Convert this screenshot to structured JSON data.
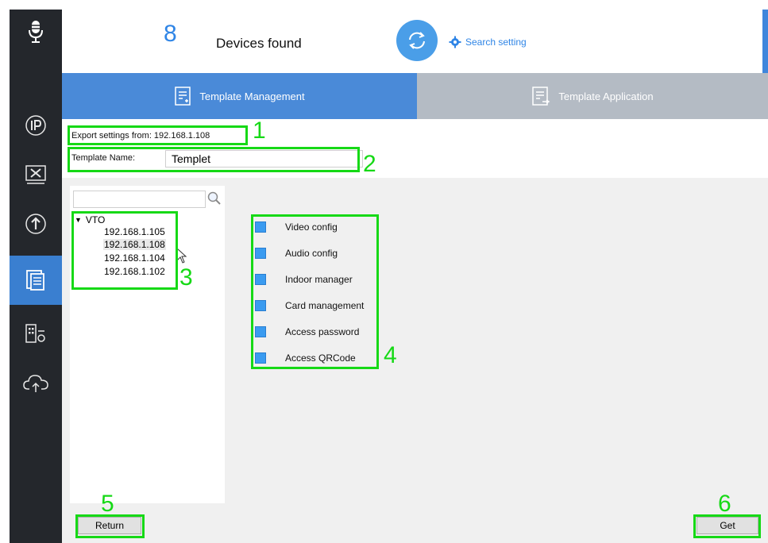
{
  "header": {
    "device_count": "8",
    "devices_label": "Devices found",
    "search_setting": "Search setting"
  },
  "window_controls": {
    "dropdown": "▾",
    "minimize": "–",
    "close": "×"
  },
  "tabs": [
    {
      "label": "Template Management",
      "active": true
    },
    {
      "label": "Template Application",
      "active": false
    }
  ],
  "export": {
    "label": "Export settings from: 192.168.1.108"
  },
  "template": {
    "label": "Template Name:",
    "value": "Templet"
  },
  "tree": {
    "search_value": "",
    "root": "VTO",
    "nodes": [
      "192.168.1.105",
      "192.168.1.108",
      "192.168.1.104",
      "192.168.1.102"
    ],
    "selected": "192.168.1.108"
  },
  "options": [
    {
      "label": "Video config",
      "checked": true
    },
    {
      "label": "Audio config",
      "checked": true
    },
    {
      "label": "Indoor manager",
      "checked": true
    },
    {
      "label": "Card management",
      "checked": true
    },
    {
      "label": "Access password",
      "checked": true
    },
    {
      "label": "Access QRCode",
      "checked": true
    }
  ],
  "buttons": {
    "return": "Return",
    "get": "Get"
  },
  "annotations": [
    "1",
    "2",
    "3",
    "4",
    "5",
    "6"
  ],
  "colors": {
    "accent": "#2f85e6",
    "sidebar": "#24272c",
    "highlight": "#16d916",
    "tab_active": "#4a8ad8",
    "tab_inactive": "#b4bbc4"
  }
}
